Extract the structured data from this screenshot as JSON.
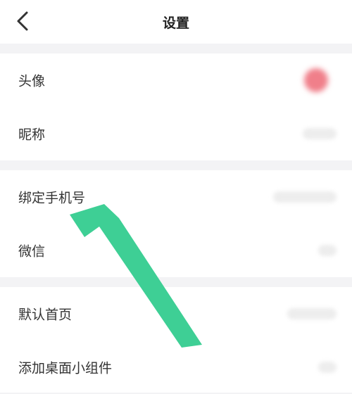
{
  "header": {
    "title": "设置",
    "back_icon": "chevron-left-icon"
  },
  "groups": [
    {
      "items": [
        {
          "label": "头像"
        },
        {
          "label": "昵称"
        }
      ]
    },
    {
      "items": [
        {
          "label": "绑定手机号"
        },
        {
          "label": "微信"
        }
      ]
    },
    {
      "items": [
        {
          "label": "默认首页"
        },
        {
          "label": "添加桌面小组件"
        }
      ]
    }
  ],
  "annotation": {
    "icon": "pointer-arrow-icon",
    "color": "#3ecf95"
  }
}
